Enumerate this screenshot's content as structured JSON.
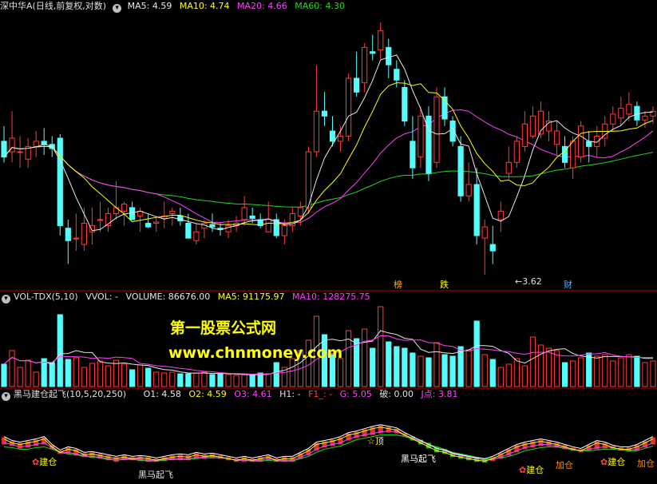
{
  "colors": {
    "bg": "#000000",
    "up": "#ff3a3a",
    "down": "#54fcfc",
    "ma5": "#e8e8e8",
    "ma10": "#ffff00",
    "ma20": "#ff40ff",
    "ma60": "#22d822",
    "grid": "#b00000",
    "label": "#e0e0e0",
    "yellow": "#ffff00",
    "green": "#20e020",
    "orange": "#ff8c00"
  },
  "main_header": {
    "title": "深中华A(日线,前复权,对数)",
    "ma5": "MA5: 4.59",
    "ma10": "MA10: 4.74",
    "ma20": "MA20: 4.66",
    "ma60": "MA60: 4.30",
    "icon": "chevron-down-icon"
  },
  "vol_header": {
    "title": "VOL-TDX(5,10)",
    "vvol": "VVOL: -",
    "volume": "VOLUME: 86676.00",
    "ma5": "MA5: 91175.97",
    "ma10": "MA10: 128275.75",
    "icon": "chevron-down-icon"
  },
  "ind_header": {
    "title": "黑马建仓起飞(10,5,20,250)",
    "o1": "O1: 4.58",
    "o2": "O2: 4.59",
    "o3": "O3: 4.61",
    "h1": "H1: -",
    "f1": "F1_: -",
    "g": "G: 5.05",
    "po": "破: 0.00",
    "j": "J点: 3.81",
    "icon": "chevron-down-icon"
  },
  "watermark": {
    "line1": "第一股票公式网",
    "line2": "www.chnmoney.com"
  },
  "annotations": {
    "low": "3.62",
    "bang": "榜",
    "die": "跌",
    "cai": "财"
  },
  "signals": [
    {
      "text": "建仓",
      "kind": "jian"
    },
    {
      "text": "黑马起飞",
      "kind": "heima"
    },
    {
      "text": "☆顶",
      "kind": "ding"
    },
    {
      "text": "黑马起飞",
      "kind": "heima"
    },
    {
      "text": "建仓",
      "kind": "jian"
    },
    {
      "text": "建仓",
      "kind": "jian"
    },
    {
      "text": "加仓",
      "kind": "jia"
    },
    {
      "text": "加仓",
      "kind": "jia"
    }
  ],
  "chart_data": {
    "type": "candlestick",
    "scale": "log",
    "price_range": [
      3.55,
      6.15
    ],
    "volume_max": 100,
    "ohlc": [
      [
        4.75,
        4.9,
        4.55,
        4.6
      ],
      [
        4.65,
        5.05,
        4.55,
        4.78
      ],
      [
        4.65,
        4.8,
        4.5,
        4.65
      ],
      [
        4.58,
        4.78,
        4.5,
        4.7
      ],
      [
        4.7,
        4.85,
        4.6,
        4.75
      ],
      [
        4.75,
        4.88,
        4.62,
        4.72
      ],
      [
        4.72,
        4.8,
        4.6,
        4.68
      ],
      [
        4.78,
        4.82,
        3.92,
        4.0
      ],
      [
        3.98,
        4.05,
        3.7,
        3.88
      ],
      [
        3.9,
        4.1,
        3.8,
        3.9
      ],
      [
        3.85,
        4.15,
        3.8,
        4.02
      ],
      [
        3.95,
        4.15,
        3.85,
        4.0
      ],
      [
        4.05,
        4.2,
        3.95,
        4.05
      ],
      [
        4.0,
        4.15,
        3.95,
        4.1
      ],
      [
        4.1,
        4.38,
        4.05,
        4.15
      ],
      [
        4.12,
        4.2,
        4.0,
        4.18
      ],
      [
        4.15,
        4.2,
        4.05,
        4.05
      ],
      [
        4.08,
        4.15,
        3.95,
        4.12
      ],
      [
        4.02,
        4.1,
        3.98,
        3.99
      ],
      [
        4.02,
        4.08,
        3.95,
        4.03
      ],
      [
        4.06,
        4.2,
        3.98,
        4.08
      ],
      [
        4.1,
        4.15,
        4.0,
        4.12
      ],
      [
        4.08,
        4.15,
        4.0,
        4.04
      ],
      [
        4.02,
        4.1,
        3.9,
        3.9
      ],
      [
        3.88,
        4.02,
        3.85,
        3.95
      ],
      [
        3.98,
        4.05,
        3.9,
        4.02
      ],
      [
        4.01,
        4.1,
        3.95,
        3.99
      ],
      [
        3.98,
        4.02,
        3.92,
        3.97
      ],
      [
        3.95,
        4.05,
        3.9,
        4.0
      ],
      [
        4.0,
        4.08,
        3.95,
        4.02
      ],
      [
        4.05,
        4.25,
        4.0,
        4.15
      ],
      [
        4.08,
        4.15,
        4.02,
        4.06
      ],
      [
        4.05,
        4.1,
        3.98,
        4.0
      ],
      [
        3.95,
        4.2,
        3.95,
        4.05
      ],
      [
        4.05,
        4.1,
        3.9,
        3.92
      ],
      [
        3.92,
        4.05,
        3.85,
        4.0
      ],
      [
        4.0,
        4.15,
        3.95,
        4.1
      ],
      [
        4.08,
        4.2,
        4.0,
        4.15
      ],
      [
        4.15,
        4.7,
        4.1,
        4.65
      ],
      [
        4.65,
        5.55,
        4.6,
        5.05
      ],
      [
        5.05,
        5.25,
        4.9,
        5.0
      ],
      [
        4.85,
        5.0,
        4.7,
        4.75
      ],
      [
        4.75,
        4.9,
        4.65,
        4.8
      ],
      [
        4.8,
        5.45,
        4.75,
        5.4
      ],
      [
        5.4,
        5.7,
        5.2,
        5.25
      ],
      [
        5.35,
        5.8,
        5.25,
        5.75
      ],
      [
        5.7,
        5.9,
        5.6,
        5.68
      ],
      [
        5.72,
        6.05,
        5.6,
        5.95
      ],
      [
        5.75,
        5.85,
        5.4,
        5.55
      ],
      [
        5.5,
        5.6,
        5.3,
        5.38
      ],
      [
        5.3,
        5.38,
        4.9,
        4.95
      ],
      [
        4.75,
        5.0,
        4.4,
        4.5
      ],
      [
        4.6,
        5.1,
        4.5,
        5.0
      ],
      [
        5.0,
        5.1,
        4.38,
        4.45
      ],
      [
        4.55,
        5.3,
        4.5,
        5.2
      ],
      [
        5.2,
        5.3,
        4.9,
        4.97
      ],
      [
        4.95,
        5.0,
        4.7,
        4.75
      ],
      [
        4.7,
        4.8,
        4.2,
        4.25
      ],
      [
        4.25,
        4.55,
        4.2,
        4.35
      ],
      [
        4.35,
        4.5,
        3.85,
        3.92
      ],
      [
        3.9,
        4.05,
        3.62,
        3.99
      ],
      [
        3.85,
        4.0,
        3.7,
        3.8
      ],
      [
        4.05,
        4.2,
        3.95,
        4.12
      ],
      [
        4.45,
        4.7,
        4.4,
        4.55
      ],
      [
        4.55,
        4.8,
        4.5,
        4.75
      ],
      [
        4.7,
        5.05,
        4.65,
        4.92
      ],
      [
        4.8,
        5.1,
        4.78,
        5.0
      ],
      [
        4.82,
        5.15,
        4.78,
        5.05
      ],
      [
        4.85,
        5.05,
        4.75,
        4.95
      ],
      [
        4.72,
        4.95,
        4.62,
        4.85
      ],
      [
        4.7,
        4.8,
        4.5,
        4.55
      ],
      [
        4.5,
        4.8,
        4.4,
        4.75
      ],
      [
        4.6,
        4.95,
        4.55,
        4.9
      ],
      [
        4.75,
        4.85,
        4.55,
        4.7
      ],
      [
        4.7,
        4.9,
        4.6,
        4.8
      ],
      [
        4.78,
        5.0,
        4.7,
        4.92
      ],
      [
        4.92,
        5.1,
        4.85,
        5.02
      ],
      [
        4.98,
        5.2,
        4.9,
        5.08
      ],
      [
        5.02,
        5.25,
        4.95,
        5.12
      ],
      [
        5.1,
        5.15,
        4.9,
        4.96
      ],
      [
        4.96,
        5.05,
        4.88,
        5.0
      ],
      [
        5.0,
        5.1,
        4.92,
        5.05
      ]
    ],
    "volume": [
      28,
      45,
      24,
      33,
      18,
      35,
      30,
      90,
      34,
      36,
      24,
      29,
      32,
      26,
      33,
      28,
      21,
      27,
      23,
      18,
      17,
      18,
      16,
      16,
      17,
      18,
      15,
      16,
      15,
      14,
      15,
      14,
      17,
      16,
      30,
      24,
      35,
      45,
      58,
      88,
      65,
      40,
      35,
      70,
      60,
      72,
      48,
      100,
      56,
      50,
      48,
      42,
      38,
      36,
      55,
      40,
      38,
      50,
      46,
      82,
      40,
      34,
      24,
      28,
      35,
      26,
      62,
      52,
      48,
      45,
      30,
      32,
      36,
      42,
      38,
      40,
      32,
      36,
      40,
      38,
      30,
      32
    ],
    "ind_a": [
      0.55,
      0.5,
      0.48,
      0.5,
      0.52,
      0.55,
      0.45,
      0.38,
      0.42,
      0.4,
      0.35,
      0.36,
      0.34,
      0.32,
      0.3,
      0.32,
      0.3,
      0.31,
      0.3,
      0.28,
      0.3,
      0.32,
      0.33,
      0.32,
      0.35,
      0.33,
      0.34,
      0.32,
      0.3,
      0.28,
      0.3,
      0.28,
      0.3,
      0.32,
      0.28,
      0.3,
      0.3,
      0.35,
      0.4,
      0.48,
      0.5,
      0.52,
      0.55,
      0.6,
      0.62,
      0.65,
      0.68,
      0.7,
      0.68,
      0.66,
      0.6,
      0.55,
      0.5,
      0.45,
      0.4,
      0.38,
      0.34,
      0.32,
      0.3,
      0.28,
      0.27,
      0.3,
      0.35,
      0.4,
      0.45,
      0.48,
      0.5,
      0.52,
      0.5,
      0.48,
      0.45,
      0.42,
      0.4,
      0.45,
      0.5,
      0.48,
      0.44,
      0.42,
      0.42,
      0.45,
      0.5,
      0.55
    ],
    "ind_b": [
      0.5,
      0.48,
      0.45,
      0.46,
      0.48,
      0.5,
      0.44,
      0.38,
      0.38,
      0.36,
      0.34,
      0.33,
      0.32,
      0.3,
      0.28,
      0.3,
      0.3,
      0.29,
      0.28,
      0.28,
      0.29,
      0.3,
      0.3,
      0.3,
      0.32,
      0.32,
      0.33,
      0.32,
      0.3,
      0.28,
      0.28,
      0.28,
      0.28,
      0.3,
      0.28,
      0.28,
      0.28,
      0.32,
      0.36,
      0.42,
      0.46,
      0.48,
      0.5,
      0.55,
      0.58,
      0.6,
      0.62,
      0.64,
      0.65,
      0.64,
      0.6,
      0.56,
      0.52,
      0.48,
      0.43,
      0.4,
      0.36,
      0.34,
      0.32,
      0.3,
      0.28,
      0.29,
      0.32,
      0.36,
      0.4,
      0.44,
      0.46,
      0.48,
      0.48,
      0.46,
      0.44,
      0.42,
      0.4,
      0.42,
      0.44,
      0.45,
      0.44,
      0.42,
      0.41,
      0.42,
      0.46,
      0.5
    ],
    "ind_c": [
      0.45,
      0.44,
      0.42,
      0.42,
      0.44,
      0.45,
      0.42,
      0.38,
      0.36,
      0.35,
      0.33,
      0.32,
      0.31,
      0.29,
      0.28,
      0.29,
      0.29,
      0.28,
      0.27,
      0.27,
      0.28,
      0.29,
      0.29,
      0.29,
      0.3,
      0.31,
      0.31,
      0.31,
      0.3,
      0.28,
      0.28,
      0.27,
      0.27,
      0.28,
      0.27,
      0.27,
      0.27,
      0.3,
      0.33,
      0.38,
      0.42,
      0.44,
      0.46,
      0.5,
      0.54,
      0.56,
      0.58,
      0.6,
      0.6,
      0.6,
      0.58,
      0.55,
      0.52,
      0.48,
      0.45,
      0.42,
      0.38,
      0.36,
      0.34,
      0.32,
      0.3,
      0.3,
      0.31,
      0.33,
      0.36,
      0.4,
      0.42,
      0.44,
      0.45,
      0.45,
      0.43,
      0.41,
      0.4,
      0.4,
      0.41,
      0.42,
      0.42,
      0.41,
      0.4,
      0.4,
      0.43,
      0.46
    ]
  }
}
